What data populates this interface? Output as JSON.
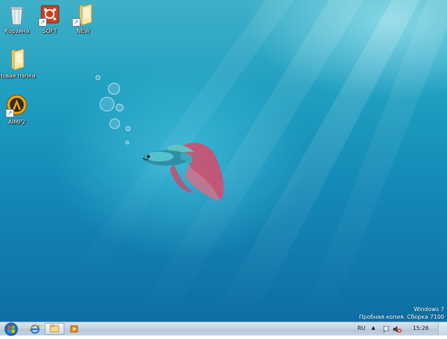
{
  "desktop": {
    "icons": [
      {
        "label": "Корзина",
        "icon": "recycle-bin-icon"
      },
      {
        "label": "SOFT",
        "icon": "soft-app-icon"
      },
      {
        "label": "NEW",
        "icon": "folder-icon"
      },
      {
        "label": "Новая папка",
        "icon": "folder-icon"
      },
      {
        "label": "AIMP2",
        "icon": "aimp-icon"
      }
    ],
    "watermark": {
      "line1": "Windows 7",
      "line2": "Пробная копия. Сборка 7100"
    }
  },
  "taskbar": {
    "pinned": [
      "internet-explorer-icon",
      "explorer-folder-icon",
      "media-player-icon"
    ],
    "tray": {
      "language": "RU",
      "time": "15:26"
    }
  },
  "colors": {
    "taskbar": "#c6d5e3",
    "desktop_top": "#3fb0c8",
    "desktop_bottom": "#0d6fa3"
  }
}
